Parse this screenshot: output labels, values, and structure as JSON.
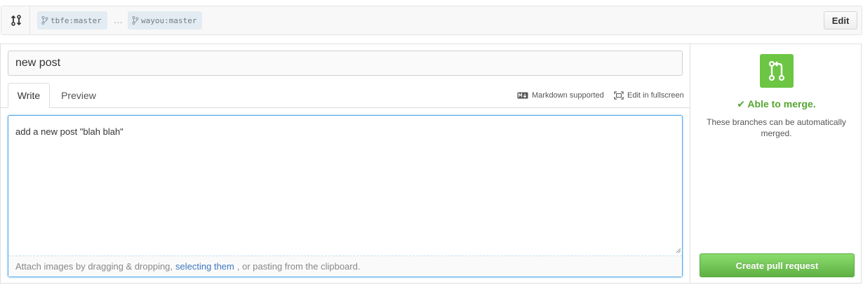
{
  "compare": {
    "base_branch": "tbfe:master",
    "separator": "…",
    "head_branch": "wayou:master",
    "edit_label": "Edit"
  },
  "form": {
    "title_value": "new post",
    "tabs": [
      {
        "label": "Write",
        "active": true
      },
      {
        "label": "Preview",
        "active": false
      }
    ],
    "markdown_label": "Markdown supported",
    "fullscreen_label": "Edit in fullscreen",
    "body_value": "add a new post \"blah blah\"",
    "attach": {
      "prefix": "Attach images by dragging & dropping,",
      "link": "selecting them",
      "suffix": ", or pasting from the clipboard."
    }
  },
  "merge": {
    "status": "Able to merge.",
    "description": "These branches can be automatically merged.",
    "create_button": "Create pull request"
  },
  "icons": {
    "compare": "git-compare-icon",
    "branch": "git-branch-icon",
    "markdown": "markdown-icon",
    "fullscreen": "fullscreen-icon",
    "merge": "git-merge-icon",
    "check": "check-icon"
  },
  "colors": {
    "accent_green": "#6cc644",
    "status_green": "#55a532",
    "focus_blue": "#51a7e8",
    "link_blue": "#4078c0",
    "branch_bg": "#e3ecf2"
  }
}
